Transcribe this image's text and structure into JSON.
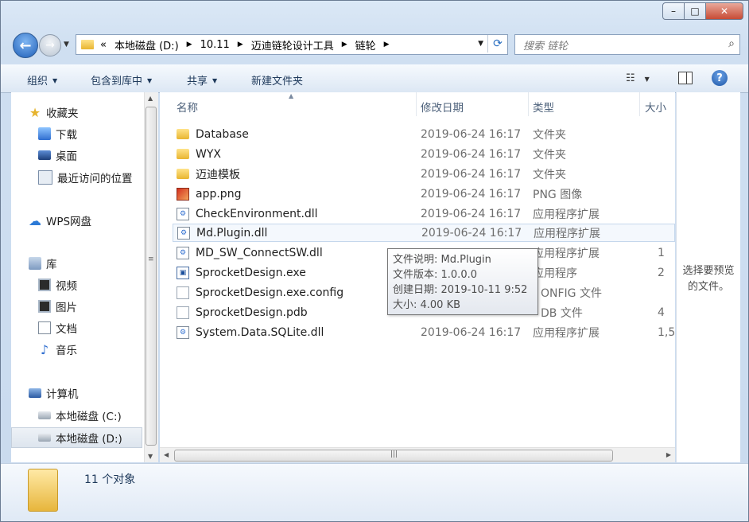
{
  "window": {
    "controls": {
      "minimize": "–",
      "maximize": "□",
      "close": "✕"
    }
  },
  "address": {
    "overflow": "«",
    "crumbs": [
      "本地磁盘 (D:)",
      "10.11",
      "迈迪链轮设计工具",
      "链轮"
    ]
  },
  "search": {
    "placeholder": "搜索 链轮"
  },
  "toolbar": {
    "organize": "组织",
    "include_library": "包含到库中",
    "share": "共享",
    "new_folder": "新建文件夹"
  },
  "navpane": {
    "favorites": "收藏夹",
    "downloads": "下载",
    "desktop": "桌面",
    "recent": "最近访问的位置",
    "wps": "WPS网盘",
    "libraries": "库",
    "videos": "视频",
    "pictures": "图片",
    "documents": "文档",
    "music": "音乐",
    "computer": "计算机",
    "drive_c": "本地磁盘 (C:)",
    "drive_d": "本地磁盘 (D:)"
  },
  "columns": {
    "name": "名称",
    "date": "修改日期",
    "type": "类型",
    "size": "大小"
  },
  "files": [
    {
      "name": "Database",
      "date": "2019-06-24 16:17",
      "type": "文件夹",
      "size": ""
    },
    {
      "name": "WYX",
      "date": "2019-06-24 16:17",
      "type": "文件夹",
      "size": ""
    },
    {
      "name": "迈迪模板",
      "date": "2019-06-24 16:17",
      "type": "文件夹",
      "size": ""
    },
    {
      "name": "app.png",
      "date": "2019-06-24 16:17",
      "type": "PNG 图像",
      "size": ""
    },
    {
      "name": "CheckEnvironment.dll",
      "date": "2019-06-24 16:17",
      "type": "应用程序扩展",
      "size": ""
    },
    {
      "name": "Md.Plugin.dll",
      "date": "2019-06-24 16:17",
      "type": "应用程序扩展",
      "size": ""
    },
    {
      "name": "MD_SW_ConnectSW.dll",
      "date": "",
      "type": "应用程序扩展",
      "size": "1"
    },
    {
      "name": "SprocketDesign.exe",
      "date": "",
      "type": "应用程序",
      "size": "2"
    },
    {
      "name": "SprocketDesign.exe.config",
      "date": "",
      "type": "ONFIG 文件",
      "size": ""
    },
    {
      "name": "SprocketDesign.pdb",
      "date": "",
      "type": "DB 文件",
      "size": "4"
    },
    {
      "name": "System.Data.SQLite.dll",
      "date": "2019-06-24 16:17",
      "type": "应用程序扩展",
      "size": "1,5"
    }
  ],
  "tooltip": {
    "desc": "文件说明: Md.Plugin",
    "version": "文件版本: 1.0.0.0",
    "created": "创建日期: 2019-10-11 9:52",
    "size": "大小: 4.00 KB"
  },
  "preview": {
    "line1": "选择要预览",
    "line2": "的文件。"
  },
  "status": {
    "count": "11 个对象"
  }
}
